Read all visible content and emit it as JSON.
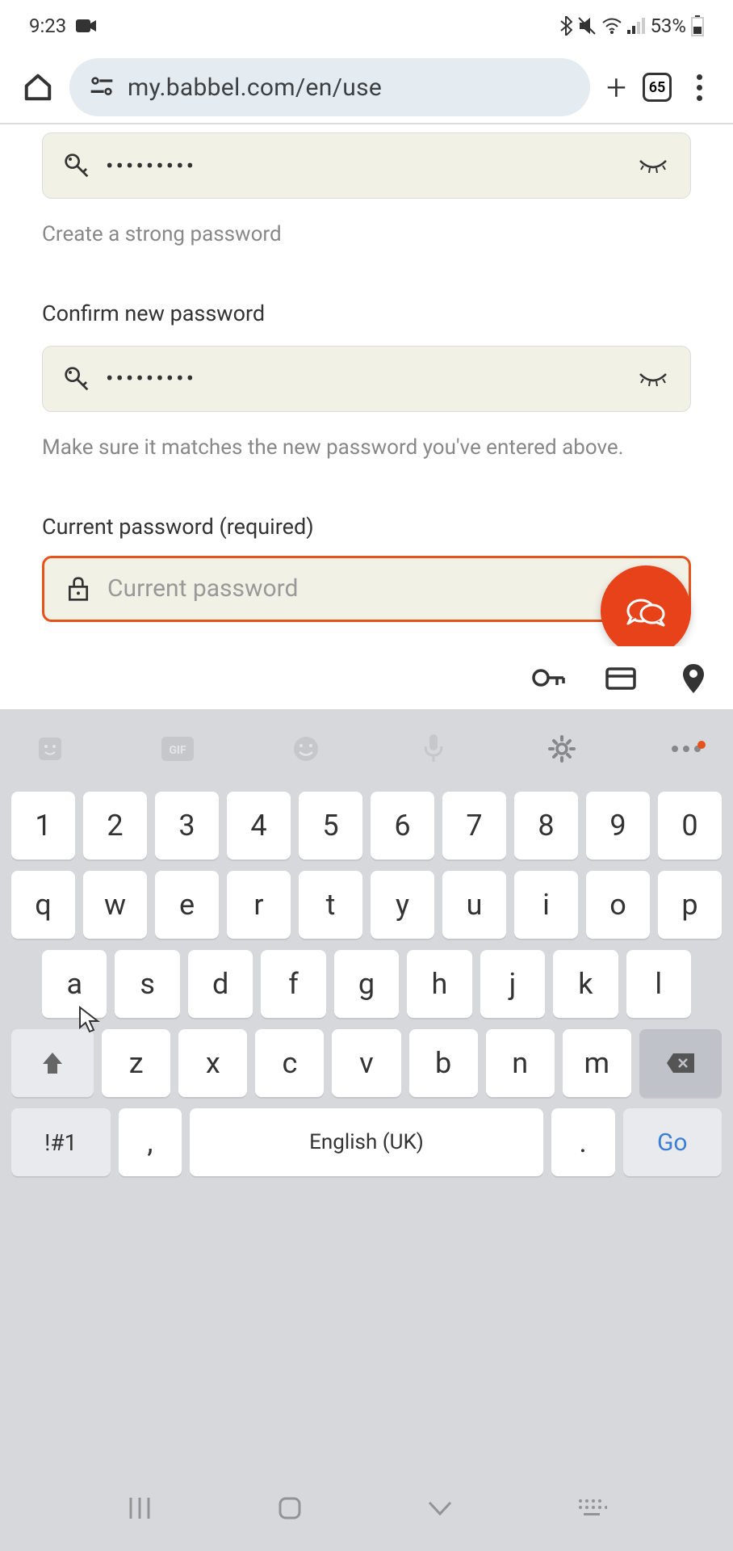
{
  "status": {
    "time": "9:23",
    "battery": "53%"
  },
  "browser": {
    "url": "my.babbel.com/en/use",
    "tabs": "65"
  },
  "form": {
    "new_password": {
      "value": "•••••••••",
      "hint": "Create a strong password"
    },
    "confirm": {
      "label": "Confirm new password",
      "value": "•••••••••",
      "hint": "Make sure it matches the new password you've entered above."
    },
    "current": {
      "label": "Current password (required)",
      "placeholder": "Current password"
    }
  },
  "keyboard": {
    "row1": [
      "1",
      "2",
      "3",
      "4",
      "5",
      "6",
      "7",
      "8",
      "9",
      "0"
    ],
    "row2": [
      "q",
      "w",
      "e",
      "r",
      "t",
      "y",
      "u",
      "i",
      "o",
      "p"
    ],
    "row3": [
      "a",
      "s",
      "d",
      "f",
      "g",
      "h",
      "j",
      "k",
      "l"
    ],
    "row4": [
      "z",
      "x",
      "c",
      "v",
      "b",
      "n",
      "m"
    ],
    "sym": "!#1",
    "comma": ",",
    "space": "English (UK)",
    "period": ".",
    "go": "Go"
  }
}
